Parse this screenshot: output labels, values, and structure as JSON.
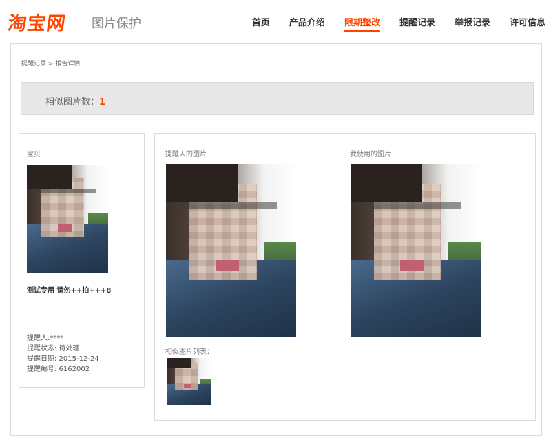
{
  "header": {
    "logo_text": "淘宝网",
    "subtitle": "图片保护",
    "nav": [
      {
        "label": "首页",
        "active": false
      },
      {
        "label": "产品介绍",
        "active": false
      },
      {
        "label": "限期整改",
        "active": true
      },
      {
        "label": "提醒记录",
        "active": false
      },
      {
        "label": "举报记录",
        "active": false
      },
      {
        "label": "许可信息",
        "active": false
      }
    ]
  },
  "breadcrumb": {
    "parent": "提醒记录",
    "separator": ">",
    "current": "报告详情"
  },
  "summary": {
    "label": "相似图片数：",
    "value": "1"
  },
  "item": {
    "section_label": "宝贝",
    "title": "测试专用 请勿++拍+++8",
    "reporter": "提醒人:****",
    "status": "提醒状态: 待处理",
    "date": "提醒日期: 2015-12-24",
    "number": "提醒编号: 6162002"
  },
  "comparison": {
    "reporter_image_label": "提醒人的图片",
    "my_image_label": "我使用的图片",
    "similar_list_label": "相似图片列表："
  },
  "colors": {
    "accent": "#ff4400",
    "border": "#dcdcdc",
    "summary_bg": "#e8e8e8"
  }
}
